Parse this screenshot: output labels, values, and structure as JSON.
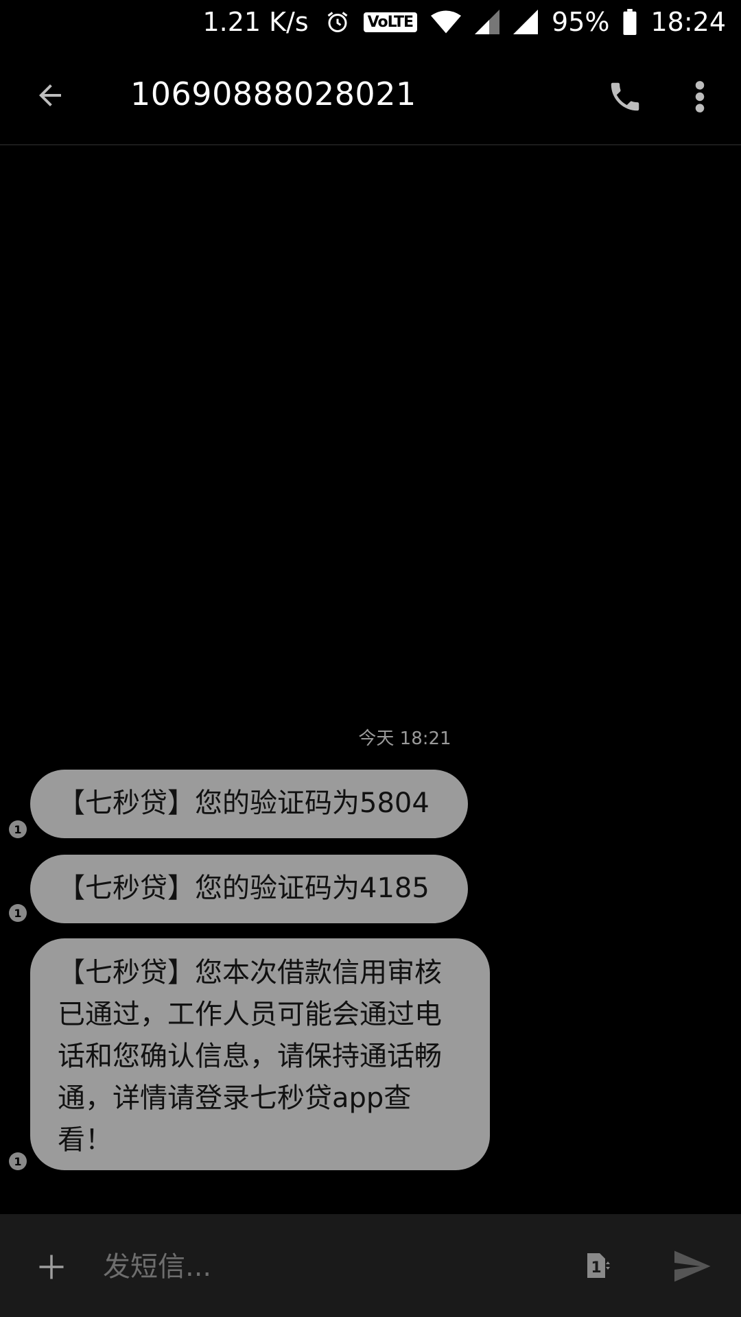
{
  "status_bar": {
    "net_speed": "1.21 K/s",
    "volte": "VoLTE",
    "battery": "95%",
    "time": "18:24",
    "icons": [
      "alarm-icon",
      "volte-icon",
      "wifi-icon",
      "signal-icon",
      "signal-icon",
      "battery-icon"
    ]
  },
  "header": {
    "title": "10690888028021",
    "icons": [
      "back-arrow-icon",
      "phone-icon",
      "more-vert-icon"
    ]
  },
  "conversation": {
    "timestamp": "今天 18:21",
    "messages": [
      {
        "text": "【七秒贷】您的验证码为5804",
        "sim": "1"
      },
      {
        "text": "【七秒贷】您的验证码为4185",
        "sim": "1"
      },
      {
        "text": "【七秒贷】您本次借款信用审核已通过，工作人员可能会通过电话和您确认信息，请保持通话畅通，详情请登录七秒贷app查看！",
        "sim": "1"
      }
    ]
  },
  "composer": {
    "placeholder": "发短信...",
    "sim_label": "1",
    "icons": [
      "add-icon",
      "sim-card-icon",
      "send-icon"
    ]
  },
  "colors": {
    "background": "#000000",
    "bubble": "#9b9b9b",
    "composer_bg": "#1a1a1a"
  }
}
